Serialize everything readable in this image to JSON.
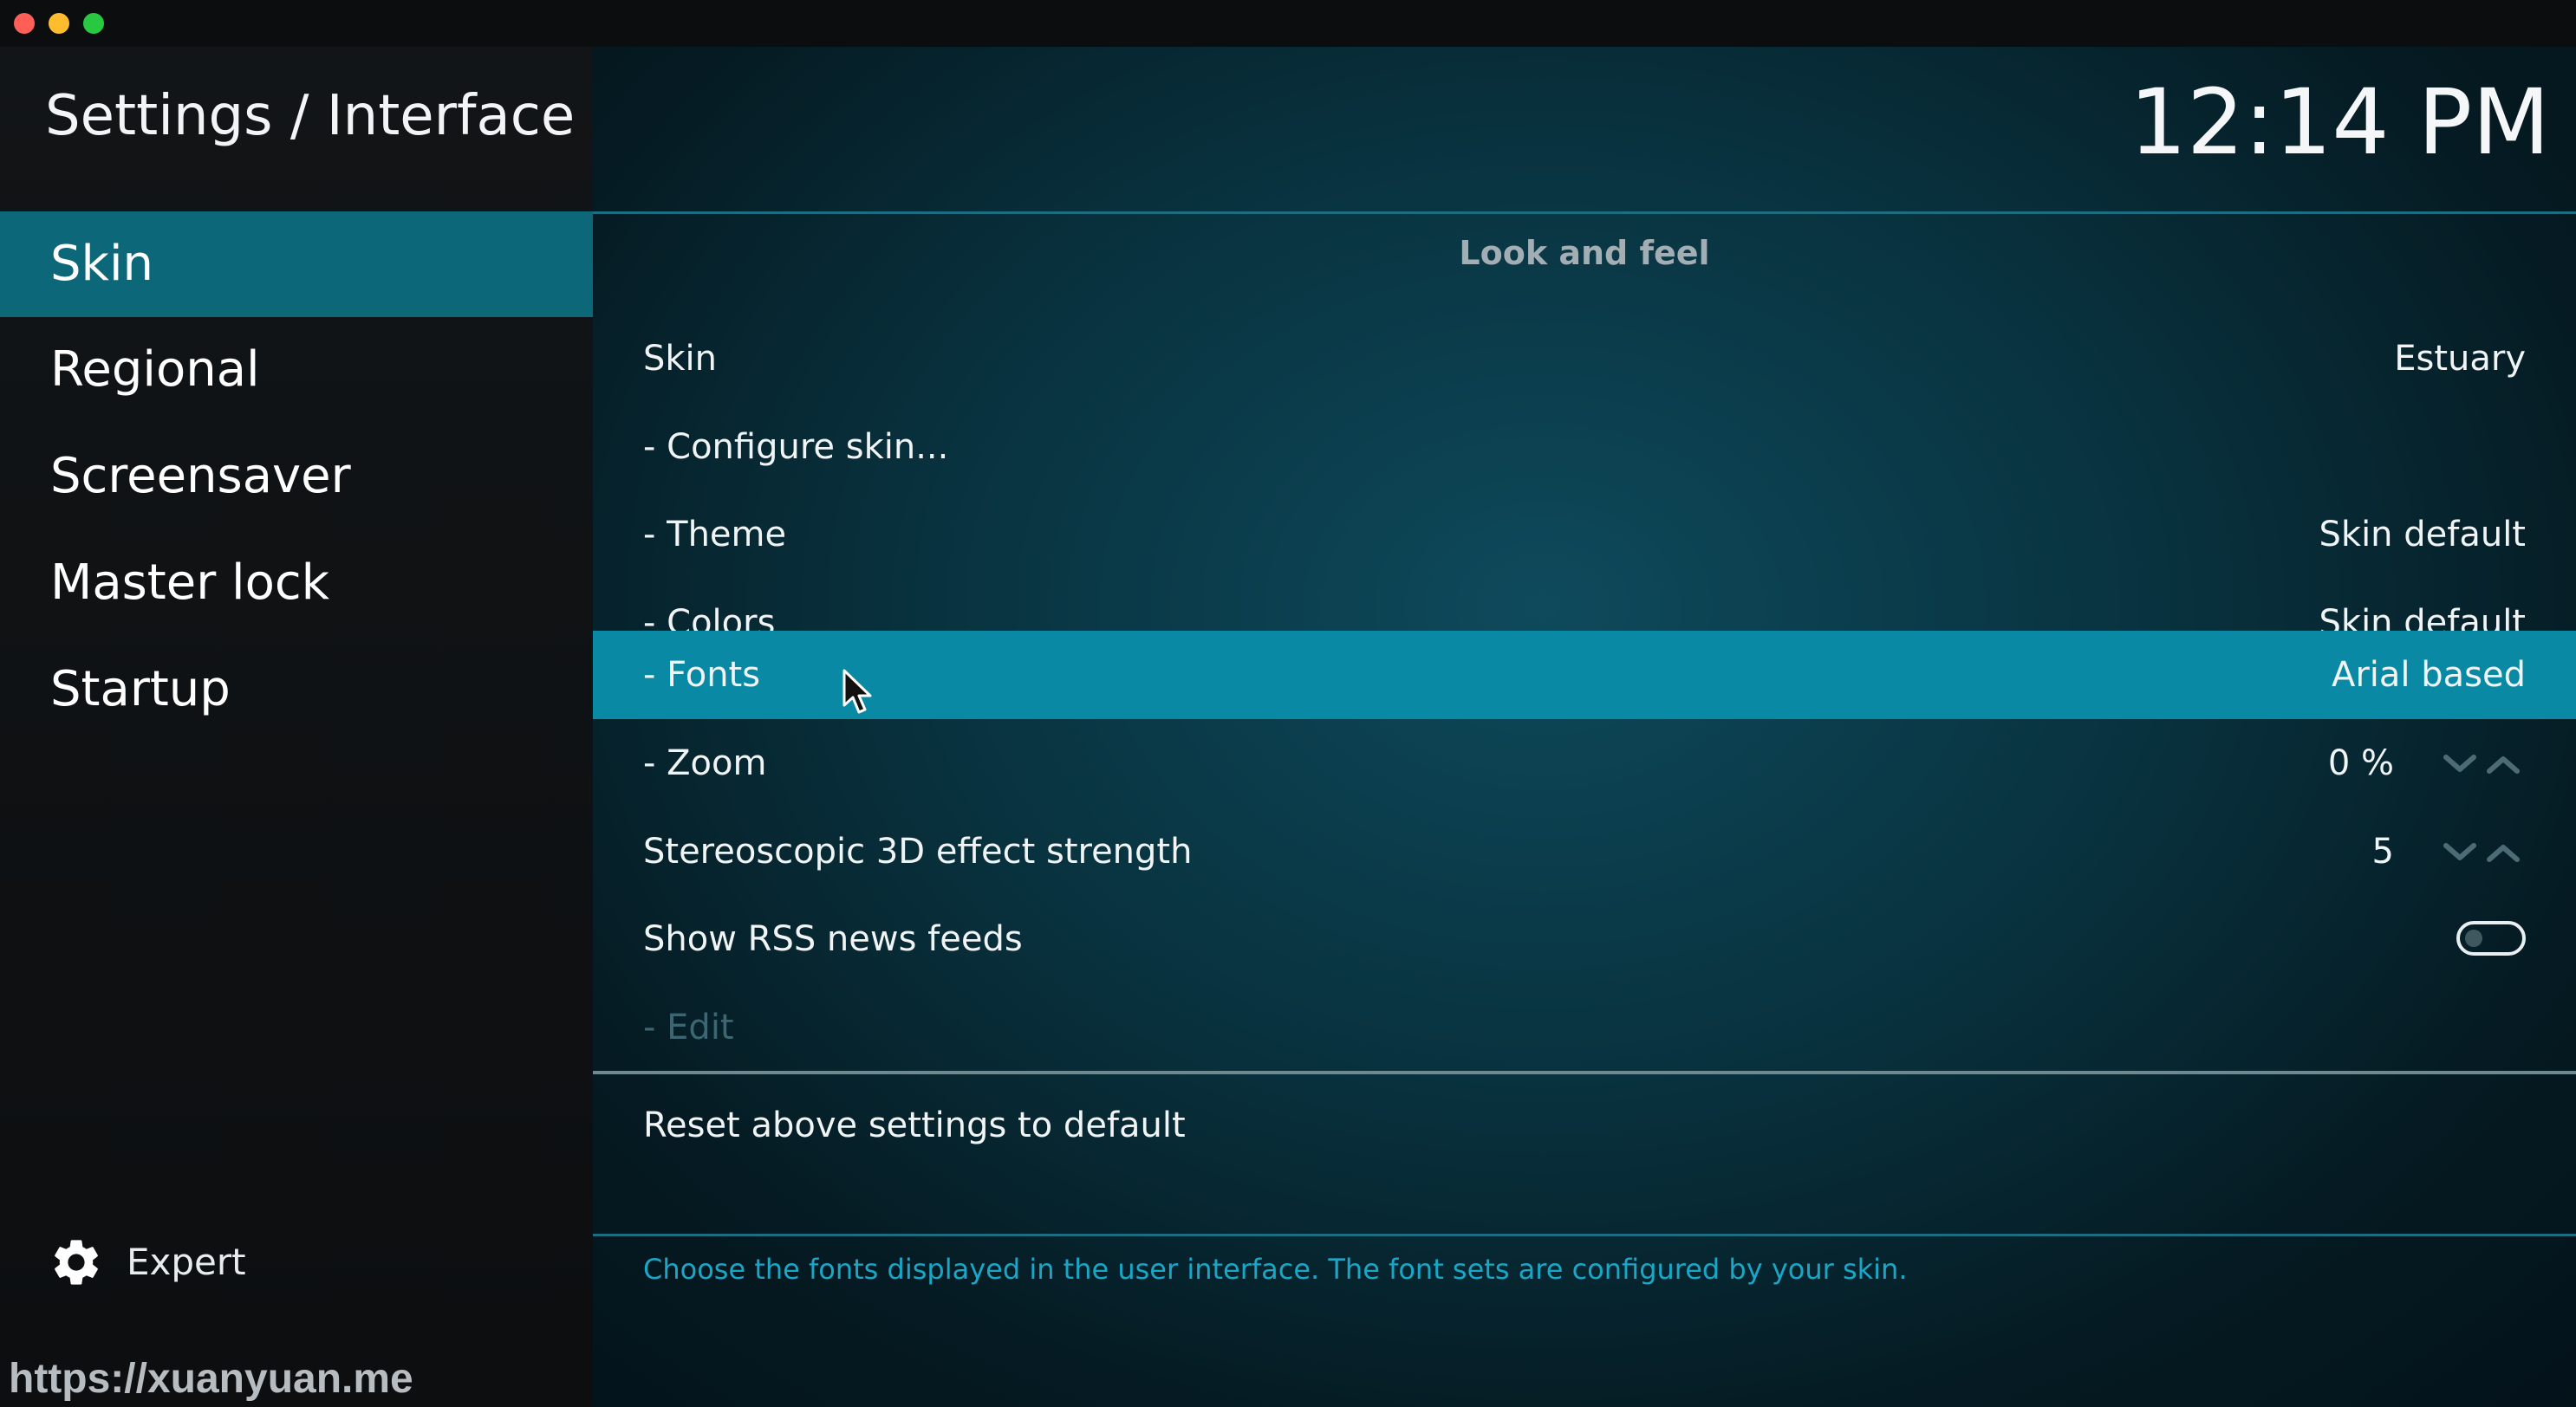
{
  "window": {
    "title_bar_buttons": [
      "close",
      "minimize",
      "maximize"
    ]
  },
  "header": {
    "title": "Settings / Interface",
    "clock": "12:14 PM"
  },
  "sidebar": {
    "items": [
      {
        "label": "Skin",
        "active": true
      },
      {
        "label": "Regional",
        "active": false
      },
      {
        "label": "Screensaver",
        "active": false
      },
      {
        "label": "Master lock",
        "active": false
      },
      {
        "label": "Startup",
        "active": false
      }
    ],
    "settings_level": {
      "icon": "gear-icon",
      "label": "Expert"
    }
  },
  "content": {
    "section_header": "Look and feel",
    "rows": [
      {
        "label": "Skin",
        "value": "Estuary"
      },
      {
        "label": "- Configure skin...",
        "value": ""
      },
      {
        "label": "- Theme",
        "value": "Skin default"
      },
      {
        "label": "- Colors",
        "value": "Skin default"
      },
      {
        "label": "- Fonts",
        "value": "Arial based",
        "focused": true
      },
      {
        "label": "- Zoom",
        "value": "0 %",
        "control": "spinner"
      },
      {
        "label": "Stereoscopic 3D effect strength",
        "value": "5",
        "control": "spinner"
      },
      {
        "label": "Show RSS news feeds",
        "control": "toggle",
        "toggle_on": false
      },
      {
        "label": "- Edit",
        "disabled": true
      }
    ],
    "reset_label": "Reset above settings to default",
    "help_text": "Choose the fonts displayed in the user interface. The font sets are configured by your skin."
  },
  "watermark": "https://xuanyuan.me",
  "colors": {
    "focus_highlight": "#0a89a4",
    "sidebar_active": "#0c6779",
    "help_text": "#1aa7c7"
  }
}
